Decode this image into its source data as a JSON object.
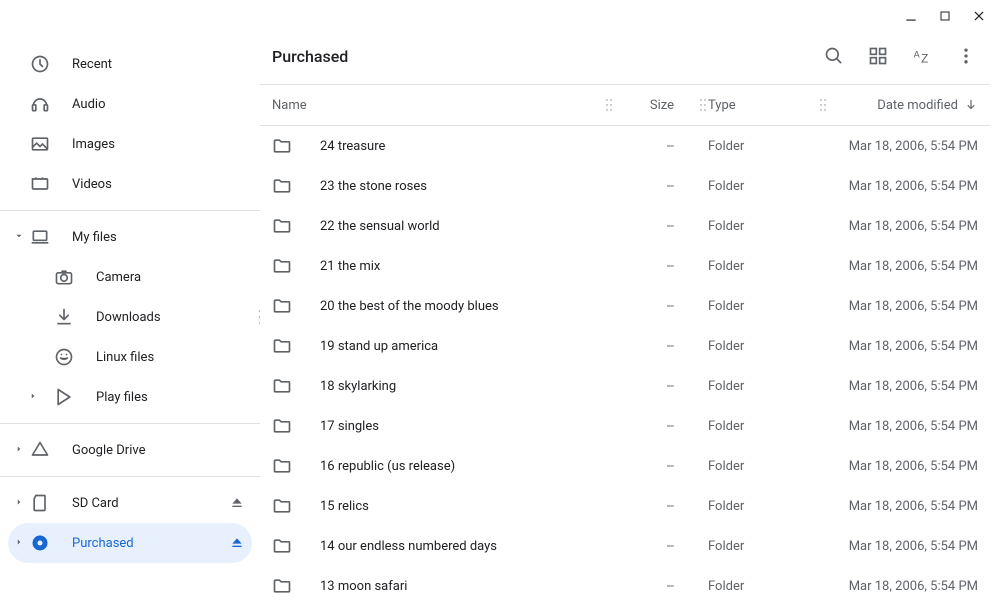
{
  "title": "Purchased",
  "window_controls": {
    "min": "minimize",
    "max": "maximize",
    "close": "close"
  },
  "toolbar_icons": [
    "search",
    "grid-view",
    "sort-az",
    "more"
  ],
  "sidebar": {
    "top": [
      {
        "icon": "recent",
        "label": "Recent"
      },
      {
        "icon": "audio",
        "label": "Audio"
      },
      {
        "icon": "images",
        "label": "Images"
      },
      {
        "icon": "videos",
        "label": "Videos"
      }
    ],
    "myfiles": {
      "label": "My files",
      "children": [
        {
          "icon": "camera",
          "label": "Camera"
        },
        {
          "icon": "downloads",
          "label": "Downloads",
          "drag_hint": true
        },
        {
          "icon": "linux",
          "label": "Linux files"
        },
        {
          "icon": "play",
          "label": "Play files",
          "expandable": true
        }
      ]
    },
    "gdrive": {
      "label": "Google Drive"
    },
    "devices": [
      {
        "icon": "sd",
        "label": "SD Card",
        "eject": true,
        "expandable": true
      },
      {
        "icon": "disc",
        "label": "Purchased",
        "eject": true,
        "expandable": true,
        "selected": true
      }
    ]
  },
  "columns": {
    "name": "Name",
    "size": "Size",
    "type": "Type",
    "date": "Date modified"
  },
  "rows": [
    {
      "name": "24 treasure",
      "size": "--",
      "type": "Folder",
      "date": "Mar 18, 2006, 5:54 PM"
    },
    {
      "name": "23 the stone roses",
      "size": "--",
      "type": "Folder",
      "date": "Mar 18, 2006, 5:54 PM"
    },
    {
      "name": "22 the sensual world",
      "size": "--",
      "type": "Folder",
      "date": "Mar 18, 2006, 5:54 PM"
    },
    {
      "name": "21 the mix",
      "size": "--",
      "type": "Folder",
      "date": "Mar 18, 2006, 5:54 PM"
    },
    {
      "name": "20 the best of the moody blues",
      "size": "--",
      "type": "Folder",
      "date": "Mar 18, 2006, 5:54 PM"
    },
    {
      "name": "19 stand up america",
      "size": "--",
      "type": "Folder",
      "date": "Mar 18, 2006, 5:54 PM"
    },
    {
      "name": "18 skylarking",
      "size": "--",
      "type": "Folder",
      "date": "Mar 18, 2006, 5:54 PM"
    },
    {
      "name": "17 singles",
      "size": "--",
      "type": "Folder",
      "date": "Mar 18, 2006, 5:54 PM"
    },
    {
      "name": "16 republic (us release)",
      "size": "--",
      "type": "Folder",
      "date": "Mar 18, 2006, 5:54 PM"
    },
    {
      "name": "15 relics",
      "size": "--",
      "type": "Folder",
      "date": "Mar 18, 2006, 5:54 PM"
    },
    {
      "name": "14 our endless numbered days",
      "size": "--",
      "type": "Folder",
      "date": "Mar 18, 2006, 5:54 PM"
    },
    {
      "name": "13 moon safari",
      "size": "--",
      "type": "Folder",
      "date": "Mar 18, 2006, 5:54 PM"
    }
  ]
}
